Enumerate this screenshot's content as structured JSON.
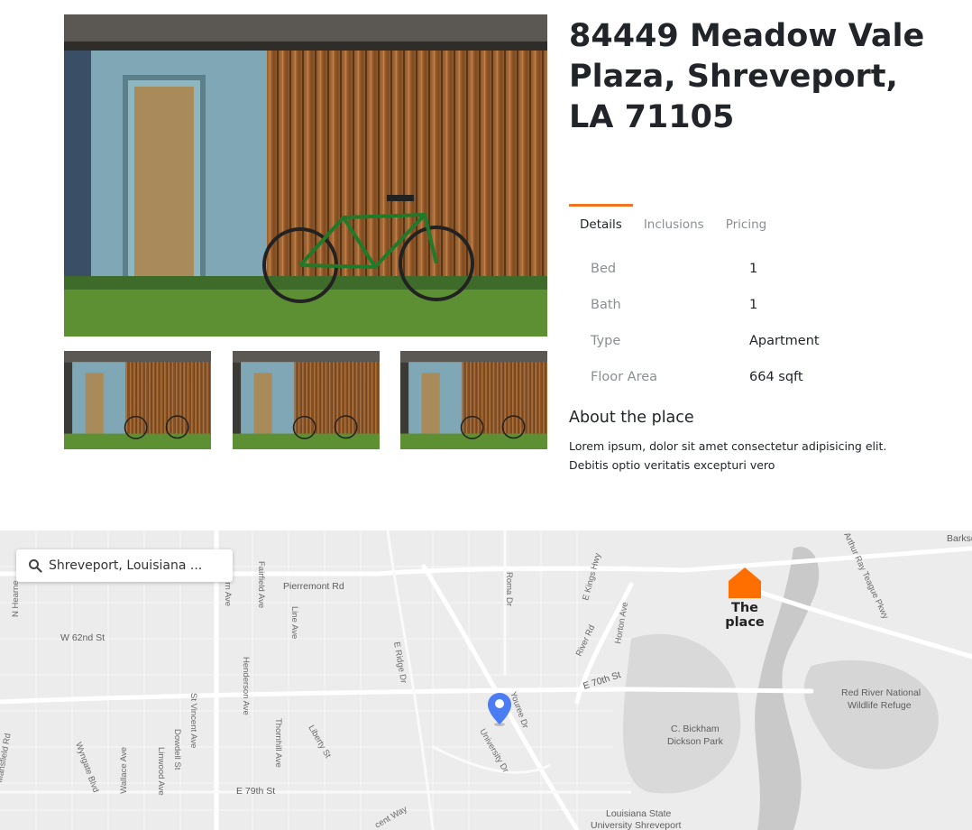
{
  "listing": {
    "address": "84449 Meadow Vale Plaza, Shreveport, LA 71105"
  },
  "tabs": [
    {
      "label": "Details",
      "active": true
    },
    {
      "label": "Inclusions",
      "active": false
    },
    {
      "label": "Pricing",
      "active": false
    }
  ],
  "details": [
    {
      "label": "Bed",
      "value": "1"
    },
    {
      "label": "Bath",
      "value": "1"
    },
    {
      "label": "Type",
      "value": "Apartment"
    },
    {
      "label": "Floor Area",
      "value": "664 sqft"
    }
  ],
  "about": {
    "title": "About the place",
    "text": "Lorem ipsum, dolor sit amet consectetur adipisicing elit. Debitis optio veritatis excepturi vero"
  },
  "map": {
    "search_value": "Shreveport, Louisiana ...",
    "place_label": "The place",
    "accent_color": "#ff6f00",
    "pin_color": "#4a7cf3",
    "labels": {
      "pierremont": "Pierremont Rd",
      "w62": "W 62nd St",
      "e70": "E 70th St",
      "e79": "E 79th St",
      "redriver1": "Red River National",
      "redriver2": "Wildlife Refuge",
      "bickham1": "C. Bickham",
      "bickham2": "Dickson Park",
      "lsu1": "Louisiana State",
      "lsu2": "University Shreveport",
      "youree": "Youree Dr",
      "university": "University Dr",
      "eridge": "E Ridge Dr",
      "liberty": "Liberty St",
      "thornhill": "Thornhill Ave",
      "henderson": "Henderson Ave",
      "line": "Line Ave",
      "fairfield": "Fairfield Ave",
      "wallace": "Wallace Ave",
      "linwood": "Linwood Ave",
      "dowdell": "Dowdell St",
      "stvincent": "St Vincent Ave",
      "wyngate": "Wyngate Blvd",
      "mansfield": "Mansfield Rd",
      "nhearne": "N Hearne",
      "roma": "Roma Dr",
      "ekings": "E Kings Hwy",
      "horton": "Horton Ave",
      "riverrd": "River Rd",
      "arthurray": "Arthur Ray Teague Pkwy",
      "barksdale": "Barksda",
      "fernave": "ern Ave",
      "crescent": "cent Way"
    }
  }
}
